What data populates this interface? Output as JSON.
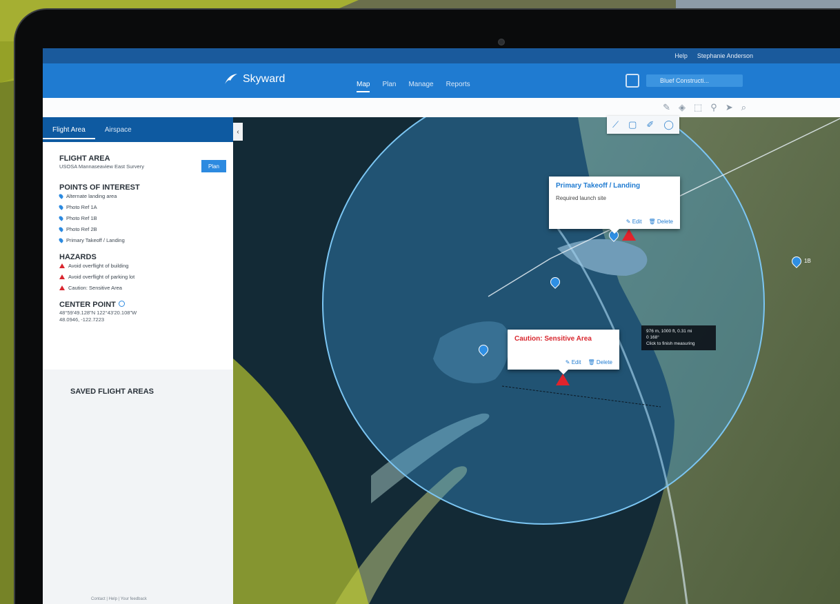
{
  "topbar": {
    "help": "Help",
    "user": "Stephanie Anderson"
  },
  "nav": {
    "brand": "Skyward",
    "links": [
      "Map",
      "Plan",
      "Manage",
      "Reports"
    ],
    "active": "Map",
    "search_value": "Bluef Constructi..."
  },
  "toolbar_icons": [
    "edit-icon",
    "layers-icon",
    "draw-icon",
    "map-pin-icon",
    "navigate-icon",
    "search-icon"
  ],
  "draw_tools": [
    "line-icon",
    "square-icon",
    "pen-icon",
    "circle-icon"
  ],
  "panel": {
    "tabs": [
      "Flight Area",
      "Airspace"
    ],
    "flight_area": {
      "heading": "FLIGHT AREA",
      "name": "USOSA Mannaseaview East Survery",
      "plan_button": "Plan"
    },
    "points_of_interest": {
      "heading": "POINTS OF INTEREST",
      "items": [
        "Alternate landing area",
        "Photo Ref 1A",
        "Photo Ref 1B",
        "Photo Ref 2B",
        "Primary Takeoff / Landing"
      ]
    },
    "hazards": {
      "heading": "HAZARDS",
      "items": [
        "Avoid overflight of building",
        "Avoid overflight of parking lot",
        "Caution: Sensitive Area"
      ]
    },
    "center_point": {
      "heading": "CENTER POINT",
      "line1": "48°59'49.128\"N 122°43'20.108\"W",
      "line2": "48.0946, -122.7223"
    },
    "saved_heading": "SAVED FLIGHT AREAS",
    "footer": "Contact  |  Help  |  Your feedback"
  },
  "map": {
    "popup_primary": {
      "title": "Primary Takeoff / Landing",
      "text": "Required launch site",
      "edit": "Edit",
      "delete": "Delete"
    },
    "popup_caution": {
      "title": "Caution: Sensitive Area",
      "edit": "Edit",
      "delete": "Delete"
    },
    "measure": {
      "line1": "976 m, 1000 ft, 0.31 mi",
      "line2": "0 168°",
      "line3": "Click to finish measuring"
    },
    "pin_label": "1B",
    "colors": {
      "flight_circle": "#3da0e6",
      "caution_zone": "#c3cf2e",
      "hazard": "#e0242c",
      "nav": "#1f7bd1"
    }
  }
}
